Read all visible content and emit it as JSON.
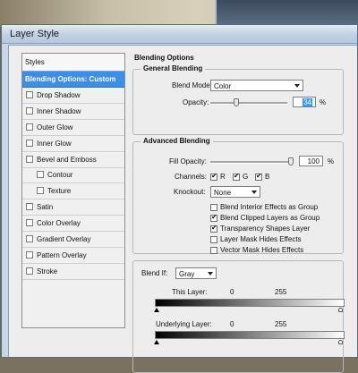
{
  "window": {
    "title": "Layer Style"
  },
  "styles_panel": {
    "header": "Styles",
    "items": [
      {
        "label": "Blending Options: Custom",
        "checkbox": false,
        "checked": false,
        "selected": true,
        "indent": 0
      },
      {
        "label": "Drop Shadow",
        "checkbox": true,
        "checked": false,
        "selected": false,
        "indent": 0
      },
      {
        "label": "Inner Shadow",
        "checkbox": true,
        "checked": false,
        "selected": false,
        "indent": 0
      },
      {
        "label": "Outer Glow",
        "checkbox": true,
        "checked": false,
        "selected": false,
        "indent": 0
      },
      {
        "label": "Inner Glow",
        "checkbox": true,
        "checked": false,
        "selected": false,
        "indent": 0
      },
      {
        "label": "Bevel and Emboss",
        "checkbox": true,
        "checked": false,
        "selected": false,
        "indent": 0
      },
      {
        "label": "Contour",
        "checkbox": true,
        "checked": false,
        "selected": false,
        "indent": 1
      },
      {
        "label": "Texture",
        "checkbox": true,
        "checked": false,
        "selected": false,
        "indent": 1
      },
      {
        "label": "Satin",
        "checkbox": true,
        "checked": false,
        "selected": false,
        "indent": 0
      },
      {
        "label": "Color Overlay",
        "checkbox": true,
        "checked": false,
        "selected": false,
        "indent": 0
      },
      {
        "label": "Gradient Overlay",
        "checkbox": true,
        "checked": false,
        "selected": false,
        "indent": 0
      },
      {
        "label": "Pattern Overlay",
        "checkbox": true,
        "checked": false,
        "selected": false,
        "indent": 0
      },
      {
        "label": "Stroke",
        "checkbox": true,
        "checked": false,
        "selected": false,
        "indent": 0
      }
    ]
  },
  "blending_options": {
    "heading": "Blending Options",
    "general": {
      "title": "General Blending",
      "blend_mode_label": "Blend Mode:",
      "blend_mode_value": "Color",
      "opacity_label": "Opacity:",
      "opacity_value": "34",
      "opacity_unit": "%",
      "opacity_fraction": 0.34
    },
    "advanced": {
      "title": "Advanced Blending",
      "fill_opacity_label": "Fill Opacity:",
      "fill_opacity_value": "100",
      "fill_opacity_unit": "%",
      "fill_opacity_fraction": 1.0,
      "channels_label": "Channels:",
      "channels": [
        {
          "label": "R",
          "checked": true
        },
        {
          "label": "G",
          "checked": true
        },
        {
          "label": "B",
          "checked": true
        }
      ],
      "knockout_label": "Knockout:",
      "knockout_value": "None",
      "options": [
        {
          "label": "Blend Interior Effects as Group",
          "checked": false
        },
        {
          "label": "Blend Clipped Layers as Group",
          "checked": true
        },
        {
          "label": "Transparency Shapes Layer",
          "checked": true
        },
        {
          "label": "Layer Mask Hides Effects",
          "checked": false
        },
        {
          "label": "Vector Mask Hides Effects",
          "checked": false
        }
      ]
    },
    "blend_if": {
      "label": "Blend If:",
      "value": "Gray",
      "this_layer_label": "This Layer:",
      "this_layer_min": "0",
      "this_layer_max": "255",
      "underlying_label": "Underlying Layer:",
      "underlying_min": "0",
      "underlying_max": "255"
    }
  },
  "colors": {
    "selection": "#3d8ee8",
    "titlebar": "#c3d2e4"
  }
}
